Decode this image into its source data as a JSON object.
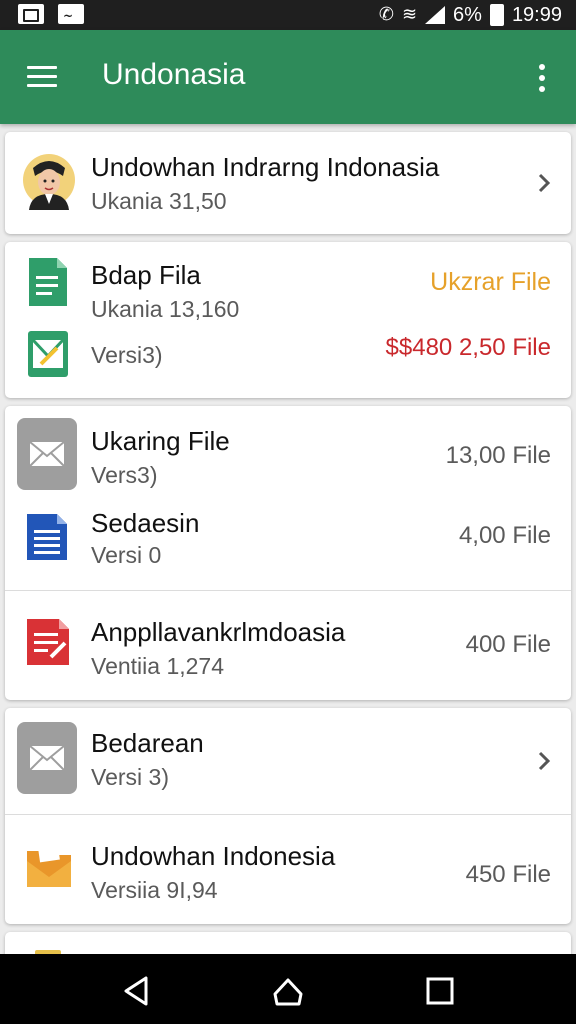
{
  "status_bar": {
    "battery": "6%",
    "time": "19:99"
  },
  "app_bar": {
    "title": "Undonasia"
  },
  "items": [
    {
      "title": "Undowhan Indrarng Indonasia",
      "subtitle": "Ukania  31,50",
      "icon": "person-avatar-icon"
    },
    {
      "title": "Bdap Fila",
      "subtitle": "Ukania  13,160",
      "right": "Ukzrar File",
      "icon": "document-file-icon"
    },
    {
      "subtitle": "Versi3)",
      "right": "$$480 2,50 File",
      "icon": "spreadsheet-file-icon"
    },
    {
      "title": "Ukaring File",
      "subtitle": "Vers3)",
      "right": "13,00 File",
      "icon": "mail-icon"
    },
    {
      "title": "Sedaesin",
      "subtitle": "Versi 0",
      "right": "4,00 File",
      "icon": "document-blue-icon"
    },
    {
      "title": "Anppllavankrlmdoasia",
      "subtitle": "Ventiia  1,274",
      "right": "400 File",
      "icon": "pdf-file-icon"
    },
    {
      "title": "Bedarean",
      "subtitle": "Versi 3)",
      "icon": "mail-icon"
    },
    {
      "title": "Undowhan Indonesia",
      "subtitle": "Versiia  9I,94",
      "right": "450 File",
      "icon": "folder-mail-icon"
    }
  ],
  "colors": {
    "app_bar": "#2e8b5a",
    "accent_orange": "#e6a12a",
    "accent_red": "#c9282c"
  }
}
